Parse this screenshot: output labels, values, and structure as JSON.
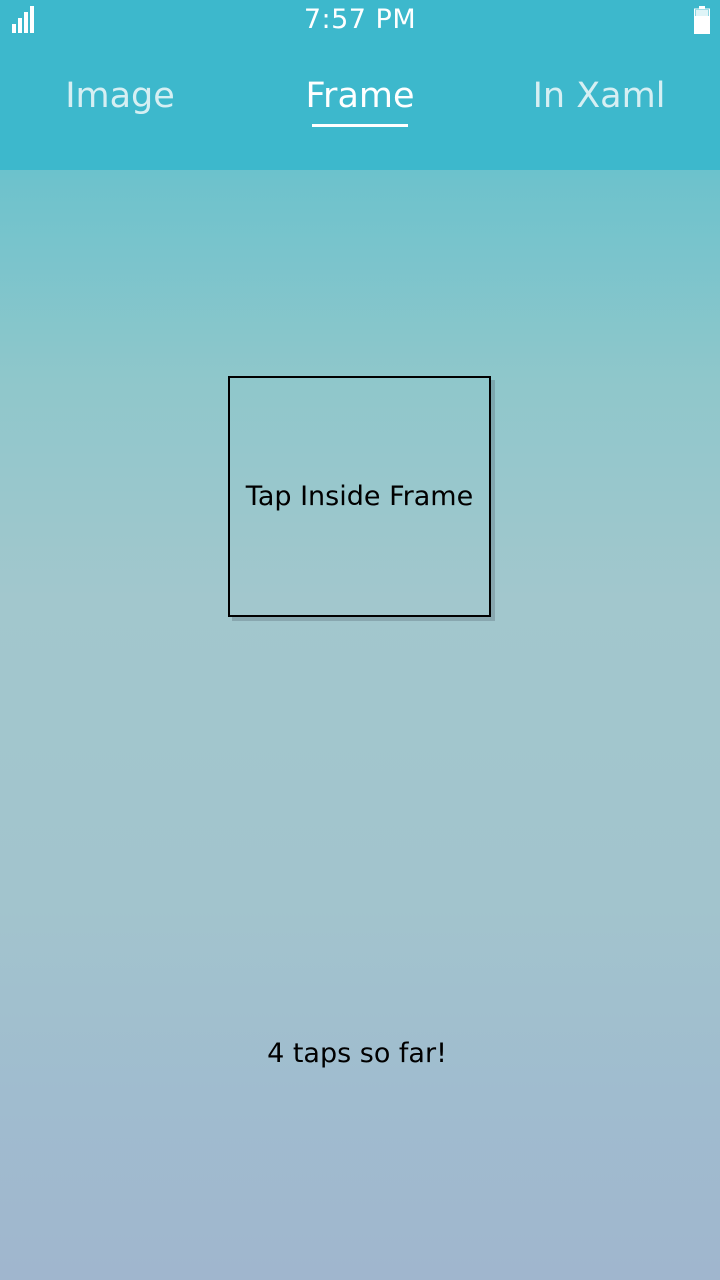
{
  "status_bar": {
    "time": "7:57 PM",
    "signal_icon": "signal-bars-icon",
    "battery_icon": "battery-icon"
  },
  "tabs": [
    {
      "label": "Image",
      "active": false
    },
    {
      "label": "Frame",
      "active": true
    },
    {
      "label": "In Xaml",
      "active": false
    }
  ],
  "main": {
    "frame_label": "Tap Inside Frame",
    "tap_count_text": "4 taps so far!"
  },
  "colors": {
    "header": "#3db8cc",
    "text": "#000000",
    "tab_active": "#ffffff",
    "tab_inactive": "#d6eff3"
  }
}
